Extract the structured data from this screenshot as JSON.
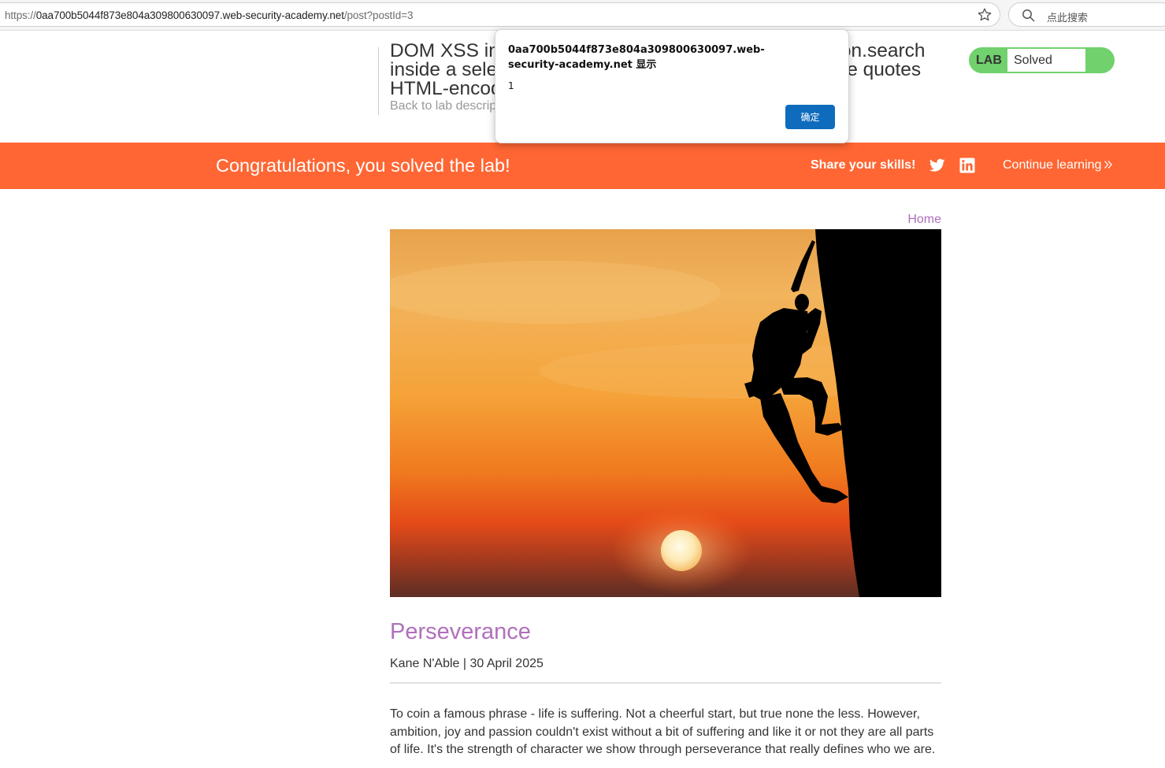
{
  "browser": {
    "url_scheme": "https://",
    "url_host": "0aa700b5044f873e804a309800630097.web-security-academy.net",
    "url_path": "/post?postId=3",
    "search_placeholder": "点此搜索"
  },
  "lab_header": {
    "title": "DOM XSS in document.write sink using source location.search inside a select element with angle brackets and double quotes HTML-encoded",
    "back_link": "Back to lab description",
    "status_badge": "LAB",
    "status_text": "Solved",
    "status_color": "#70d16d"
  },
  "banner": {
    "message": "Congratulations, you solved the lab!",
    "share_label": "Share your skills!",
    "continue_label": "Continue learning",
    "color": "#ff6633"
  },
  "nav": {
    "home_link": "Home"
  },
  "post": {
    "title": "Perseverance",
    "author_date": "Kane N'Able | 30 April 2025",
    "body": "To coin a famous phrase - life is suffering. Not a cheerful start, but true none the less. However, ambition, joy and passion couldn't exist without a bit of suffering and like it or not they are all parts of life. It's the strength of character we show through perseverance that really defines who we are.",
    "link_color": "#b06fbc"
  },
  "alert_dialog": {
    "origin_text": "0aa700b5044f873e804a309800630097.web-security-academy.net 显示",
    "message": "1",
    "ok_button": "确定",
    "button_color": "#0f6cbd"
  },
  "icons": [
    "star-icon",
    "search-icon",
    "twitter-icon",
    "linkedin-icon",
    "chevrons-right-icon"
  ]
}
